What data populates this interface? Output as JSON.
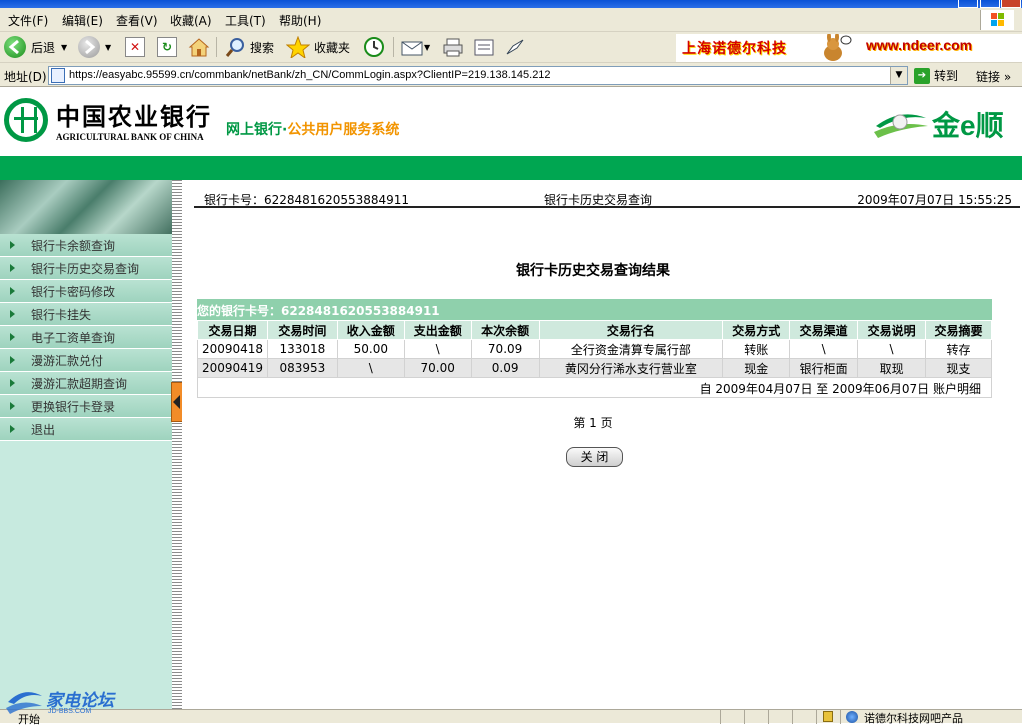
{
  "browser": {
    "menu": [
      "文件(F)",
      "编辑(E)",
      "查看(V)",
      "收藏(A)",
      "工具(T)",
      "帮助(H)"
    ],
    "toolbar": {
      "back": "后退",
      "search": "搜索",
      "favorites": "收藏夹"
    },
    "ad_text": "上海诺德尔科技",
    "ad_url": "www.ndeer.com",
    "address_label": "地址(D)",
    "address_url": "https://easyabc.95599.cn/commbank/netBank/zh_CN/CommLogin.aspx?ClientIP=219.138.145.212",
    "go_label": "转到",
    "links_label": "链接",
    "status_text": "诺德尔科技网吧产品",
    "start_label": "开始"
  },
  "bank": {
    "name_cn": "中国农业银行",
    "name_en": "AGRICULTURAL BANK OF CHINA",
    "subtitle_a": "网上银行·",
    "subtitle_b": "公共用户服务系统",
    "brand": "金e顺"
  },
  "sidebar": {
    "items": [
      "银行卡余额查询",
      "银行卡历史交易查询",
      "银行卡密码修改",
      "银行卡挂失",
      "电子工资单查询",
      "漫游汇款兑付",
      "漫游汇款超期查询",
      "更换银行卡登录",
      "退出"
    ]
  },
  "main": {
    "card_label": "银行卡号：6228481620553884911",
    "page_heading": "银行卡历史交易查询",
    "timestamp": "2009年07月07日  15:55:25",
    "result_title": "银行卡历史交易查询结果",
    "card_banner": "您的银行卡号：6228481620553884911",
    "table": {
      "headers": [
        "交易日期",
        "交易时间",
        "收入金额",
        "支出金额",
        "本次余额",
        "交易行名",
        "交易方式",
        "交易渠道",
        "交易说明",
        "交易摘要"
      ],
      "rows": [
        [
          "20090418",
          "133018",
          "50.00",
          "\\",
          "70.09",
          "全行资金清算专属行部",
          "转账",
          "\\",
          "\\",
          "转存"
        ],
        [
          "20090419",
          "083953",
          "\\",
          "70.00",
          "0.09",
          "黄冈分行浠水支行营业室",
          "现金",
          "银行柜面",
          "取现",
          "现支"
        ]
      ]
    },
    "period": "自  2009年04月07日  至  2009年06月07日  账户明细",
    "page_indicator": "第  1  页",
    "close_label": "关  闭"
  },
  "forum": {
    "name": "家电论坛",
    "url": "JD-BBS.COM"
  },
  "colors": {
    "abc_green": "#009844",
    "band_green": "#00a651",
    "banner_green": "#8fd0ac",
    "sidebar_bg": "#c7eadf",
    "ad_red": "#d40000"
  }
}
